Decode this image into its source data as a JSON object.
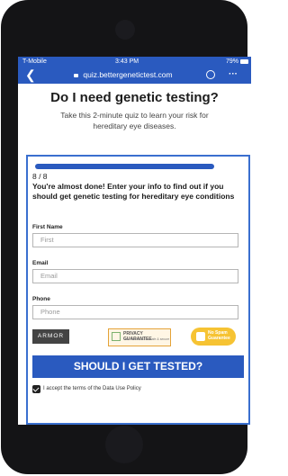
{
  "status_bar": {
    "carrier": "T-Mobile",
    "time": "3:43 PM",
    "battery": "79%"
  },
  "browser": {
    "back_icon": "chevron-left",
    "url": "quiz.bettergenetictest.com",
    "more": "···"
  },
  "page": {
    "headline": "Do I need genetic testing?",
    "subheadline": "Take this 2-minute quiz to learn your risk for hereditary eye diseases."
  },
  "form": {
    "progress": 1.0,
    "step": "8 / 8",
    "prompt": "You're almost done! Enter your info to find out if you should get genetic testing for hereditary eye conditions",
    "first_name": {
      "label": "First Name",
      "placeholder": "First"
    },
    "email": {
      "label": "Email",
      "placeholder": "Email"
    },
    "phone": {
      "label": "Phone",
      "placeholder": "Phone"
    },
    "badges": {
      "armor": "ARMOR",
      "privacy_title": "PRIVACY GUARANTEE",
      "privacy_sub": "Your information is safe & secure",
      "spam": "No Spam Guarantee"
    },
    "submit_label": "SHOULD I GET TESTED?",
    "terms_label": "I accept the terms of the Data Use Policy"
  }
}
